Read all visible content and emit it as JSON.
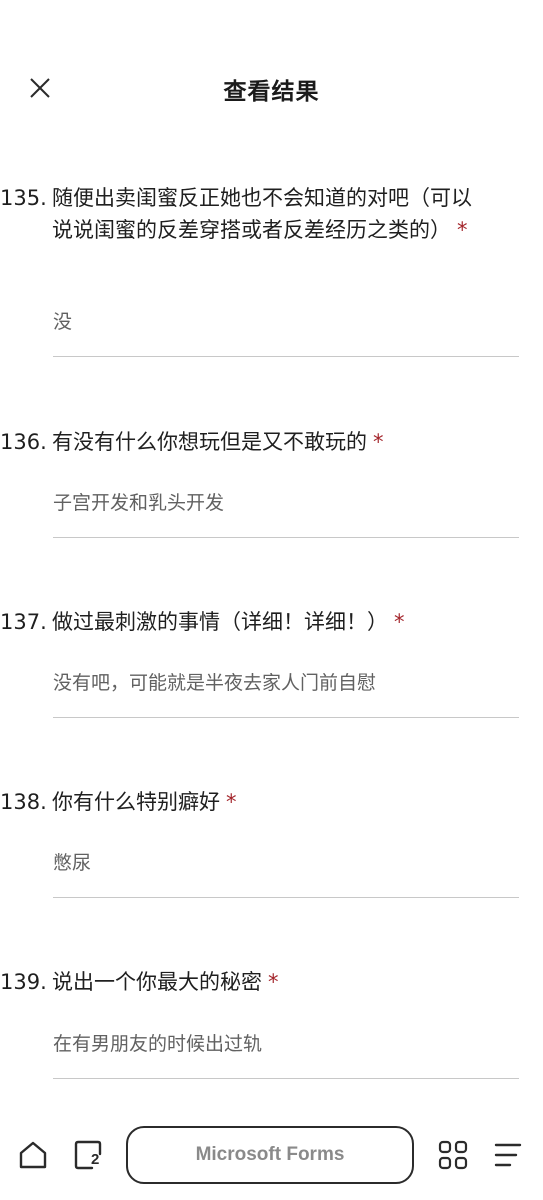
{
  "header": {
    "title": "查看结果",
    "close_icon": "close-icon"
  },
  "questions": [
    {
      "number": "135.",
      "text": "随便出卖闺蜜反正她也不会知道的对吧（可以说说闺蜜的反差穿搭或者反差经历之类的）",
      "required_mark": "*",
      "answer": "没"
    },
    {
      "number": "136.",
      "text": "有没有什么你想玩但是又不敢玩的",
      "required_mark": "*",
      "answer": "子宫开发和乳头开发"
    },
    {
      "number": "137.",
      "text": "做过最刺激的事情（详细！详细！）",
      "required_mark": "*",
      "answer": "没有吧，可能就是半夜去家人门前自慰"
    },
    {
      "number": "138.",
      "text": "你有什么特别癖好",
      "required_mark": "*",
      "answer": "憋尿"
    },
    {
      "number": "139.",
      "text": "说出一个你最大的秘密",
      "required_mark": "*",
      "answer": "在有男朋友的时候出过轨"
    }
  ],
  "toolbar": {
    "address": "Microsoft Forms",
    "tab_count": "2",
    "icons": [
      "home-icon",
      "tabs-icon",
      "apps-grid-icon",
      "menu-icon"
    ]
  },
  "colors": {
    "required": "#a4262c",
    "answer_text": "#616161",
    "divider": "#c8c8c8"
  }
}
